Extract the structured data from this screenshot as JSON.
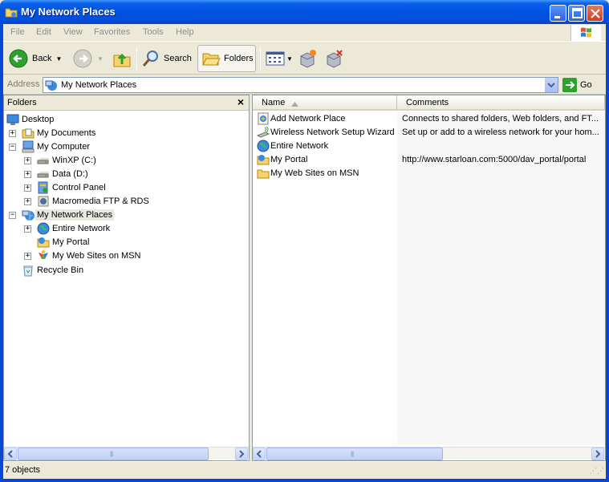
{
  "window": {
    "title": "My Network Places",
    "menu": [
      "File",
      "Edit",
      "View",
      "Favorites",
      "Tools",
      "Help"
    ]
  },
  "toolbar": {
    "back_label": "Back",
    "search_label": "Search",
    "folders_label": "Folders"
  },
  "address": {
    "label": "Address",
    "value": "My Network Places",
    "go_label": "Go"
  },
  "folders_pane": {
    "title": "Folders",
    "close_glyph": "×",
    "tree": [
      {
        "label": "Desktop",
        "icon": "desktop-icon"
      },
      {
        "label": "My Documents",
        "icon": "my-documents-icon"
      },
      {
        "label": "My Computer",
        "icon": "my-computer-icon"
      },
      {
        "label": "WinXP (C:)",
        "icon": "hard-drive-icon"
      },
      {
        "label": "Data (D:)",
        "icon": "hard-drive-icon"
      },
      {
        "label": "Control Panel",
        "icon": "control-panel-icon"
      },
      {
        "label": "Macromedia FTP & RDS",
        "icon": "ftp-icon"
      },
      {
        "label": "My Network Places",
        "icon": "network-places-icon"
      },
      {
        "label": "Entire Network",
        "icon": "globe-icon"
      },
      {
        "label": "My Portal",
        "icon": "portal-folder-icon"
      },
      {
        "label": "My Web Sites on MSN",
        "icon": "msn-icon"
      },
      {
        "label": "Recycle Bin",
        "icon": "recycle-bin-icon"
      }
    ]
  },
  "list": {
    "columns": [
      "Name",
      "Comments"
    ],
    "items": [
      {
        "name": "Add Network Place",
        "comment": "Connects to shared folders, Web folders, and FT..."
      },
      {
        "name": "Wireless Network Setup Wizard",
        "comment": "Set up or add to a wireless network for your hom..."
      },
      {
        "name": "Entire Network",
        "comment": ""
      },
      {
        "name": "My Portal",
        "comment": "http://www.starloan.com:5000/dav_portal/portal"
      },
      {
        "name": "My Web Sites on MSN",
        "comment": ""
      }
    ]
  },
  "status": {
    "text": "7 objects"
  },
  "colors": {
    "title_blue": "#0054E3",
    "selection": "#E8E8E0"
  }
}
